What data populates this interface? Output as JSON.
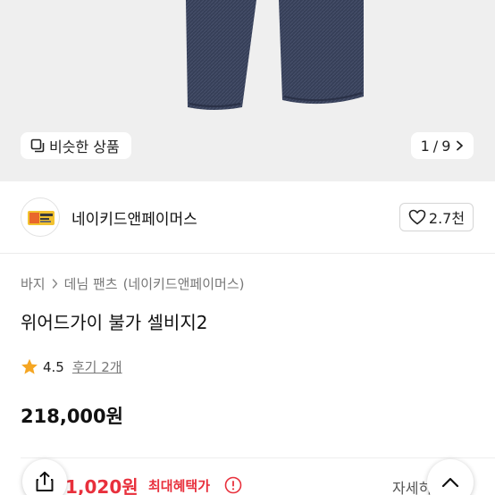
{
  "gallery": {
    "similar_label": "비슷한 상품",
    "current_index": "1",
    "total": "9",
    "separator": "/"
  },
  "brand": {
    "name": "네이키드앤페이머스",
    "likes": "2.7천"
  },
  "breadcrumb": {
    "category": "바지",
    "subcategory": "데님 팬츠",
    "brand_tag": "(네이키드앤페이머스)"
  },
  "product": {
    "title": "위어드가이 불가 셀비지2",
    "rating": "4.5",
    "reviews_label": "후기 2개",
    "price": "218,000원"
  },
  "benefit": {
    "price": "1,020원",
    "label": "최대혜택가",
    "detail_label": "자세히"
  },
  "colors": {
    "accent_red": "#e8303c",
    "star": "#f5a623",
    "denim": "#363f58"
  },
  "icons": {
    "similar": "copy-icon",
    "next": "chevron-right-icon",
    "like": "heart-icon",
    "star": "star-icon",
    "info": "info-icon",
    "share": "share-icon",
    "top": "chevron-up-icon"
  }
}
